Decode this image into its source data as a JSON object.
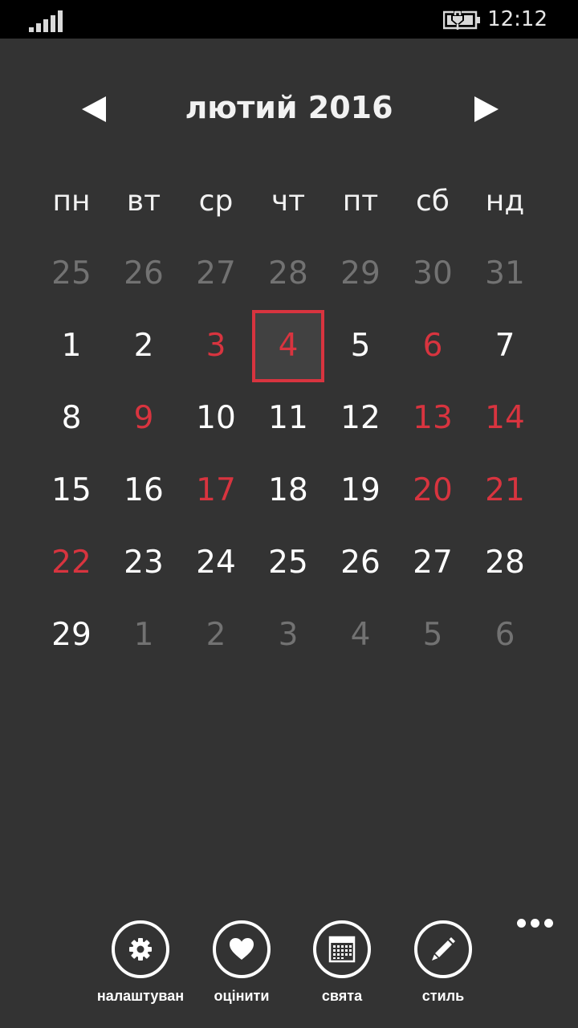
{
  "status_bar": {
    "signal_icon": "signal-strength-icon",
    "battery_icon": "battery-charging-icon",
    "time": "12:12"
  },
  "calendar": {
    "title": "лютий 2016",
    "prev_icon": "arrow-left-icon",
    "next_icon": "arrow-right-icon",
    "weekdays": [
      "пн",
      "вт",
      "ср",
      "чт",
      "пт",
      "сб",
      "нд"
    ],
    "weeks": [
      [
        {
          "day": "25",
          "kind": "other"
        },
        {
          "day": "26",
          "kind": "other"
        },
        {
          "day": "27",
          "kind": "other"
        },
        {
          "day": "28",
          "kind": "other"
        },
        {
          "day": "29",
          "kind": "other"
        },
        {
          "day": "30",
          "kind": "other"
        },
        {
          "day": "31",
          "kind": "other"
        }
      ],
      [
        {
          "day": "1",
          "kind": "normal"
        },
        {
          "day": "2",
          "kind": "normal"
        },
        {
          "day": "3",
          "kind": "holiday"
        },
        {
          "day": "4",
          "kind": "today"
        },
        {
          "day": "5",
          "kind": "normal"
        },
        {
          "day": "6",
          "kind": "holiday"
        },
        {
          "day": "7",
          "kind": "normal"
        }
      ],
      [
        {
          "day": "8",
          "kind": "normal"
        },
        {
          "day": "9",
          "kind": "holiday"
        },
        {
          "day": "10",
          "kind": "normal"
        },
        {
          "day": "11",
          "kind": "normal"
        },
        {
          "day": "12",
          "kind": "normal"
        },
        {
          "day": "13",
          "kind": "holiday"
        },
        {
          "day": "14",
          "kind": "holiday"
        }
      ],
      [
        {
          "day": "15",
          "kind": "normal"
        },
        {
          "day": "16",
          "kind": "normal"
        },
        {
          "day": "17",
          "kind": "holiday"
        },
        {
          "day": "18",
          "kind": "normal"
        },
        {
          "day": "19",
          "kind": "normal"
        },
        {
          "day": "20",
          "kind": "holiday"
        },
        {
          "day": "21",
          "kind": "holiday"
        }
      ],
      [
        {
          "day": "22",
          "kind": "holiday"
        },
        {
          "day": "23",
          "kind": "normal"
        },
        {
          "day": "24",
          "kind": "normal"
        },
        {
          "day": "25",
          "kind": "normal"
        },
        {
          "day": "26",
          "kind": "normal"
        },
        {
          "day": "27",
          "kind": "normal"
        },
        {
          "day": "28",
          "kind": "normal"
        }
      ],
      [
        {
          "day": "29",
          "kind": "normal"
        },
        {
          "day": "1",
          "kind": "other"
        },
        {
          "day": "2",
          "kind": "other"
        },
        {
          "day": "3",
          "kind": "other"
        },
        {
          "day": "4",
          "kind": "other"
        },
        {
          "day": "5",
          "kind": "other"
        },
        {
          "day": "6",
          "kind": "other"
        }
      ]
    ]
  },
  "app_bar": {
    "more_icon": "more-dots-icon",
    "buttons": [
      {
        "label": "налаштуван",
        "icon": "gear-icon"
      },
      {
        "label": "оцінити",
        "icon": "heart-icon"
      },
      {
        "label": "свята",
        "icon": "calendar-icon"
      },
      {
        "label": "стиль",
        "icon": "pencil-icon"
      }
    ]
  },
  "colors": {
    "background": "#333333",
    "status_bar": "#000000",
    "text": "#ffffff",
    "muted_day": "#727272",
    "holiday": "#d8343f",
    "today_border": "#d8343f",
    "today_fill": "#414141"
  }
}
